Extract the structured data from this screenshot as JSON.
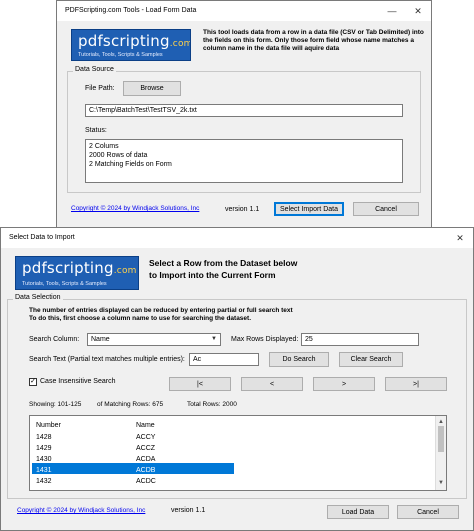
{
  "window1": {
    "title": "PDFScripting.com Tools - Load Form Data",
    "logo": {
      "main": "pdfscripting",
      "suffix": ".com",
      "tagline": "Tutorials, Tools, Scripts & Samples"
    },
    "description": "This tool loads data from a row in a data file (CSV or Tab Delimited) into the fields on this form. Only those form field whose name matches a column name in the data file will aquire data",
    "group_label": "Data Source",
    "file_path_label": "File Path:",
    "browse_label": "Browse",
    "file_path_value": "C:\\Temp\\BatchTest\\TestTSV_2k.txt",
    "status_label": "Status:",
    "status_lines": [
      "2 Colums",
      "2000 Rows of data",
      "2 Matching Fields on Form"
    ],
    "copyright": "Copyright © 2024 by Windjack Solutions, Inc",
    "version": "version 1.1",
    "select_import_label": "Select Import Data",
    "cancel_label": "Cancel",
    "min_glyph": "—",
    "close_glyph": "✕"
  },
  "window2": {
    "title": "Select Data to Import",
    "close_glyph": "✕",
    "logo": {
      "main": "pdfscripting",
      "suffix": ".com",
      "tagline": "Tutorials, Tools, Scripts & Samples"
    },
    "heading_line1": "Select a Row from the Dataset below",
    "heading_line2": "to Import into the Current Form",
    "group_label": "Data Selection",
    "instr_line1": "The number of entries displayed can be reduced by entering partial or full search text",
    "instr_line2": "To do this, first choose a column name to use for searching the dataset.",
    "search_column_label": "Search Column:",
    "search_column_value": "Name",
    "max_rows_label": "Max Rows Displayed:",
    "max_rows_value": "25",
    "search_text_label": "Search Text (Partial text matches multiple entries):",
    "search_text_value": "Ac",
    "do_search_label": "Do Search",
    "clear_search_label": "Clear Search",
    "case_insensitive_label": "Case Insensitive Search",
    "case_insensitive_checked": "✓",
    "nav_first": "|<",
    "nav_prev": "<",
    "nav_next": ">",
    "nav_last": ">|",
    "showing_label": "Showing: 101-125",
    "matching_label": "of Matching Rows: 675",
    "total_label": "Total Rows: 2000",
    "list_headers": [
      "Number",
      "Name"
    ],
    "list_rows": [
      [
        "1428",
        "ACCY"
      ],
      [
        "1429",
        "ACCZ"
      ],
      [
        "1430",
        "ACDA"
      ],
      [
        "1431",
        "ACDB"
      ],
      [
        "1432",
        "ACDC"
      ]
    ],
    "selected_row_index": 3,
    "scroll_up": "▲",
    "scroll_down": "▼",
    "copyright": "Copyright © 2024 by Windjack Solutions, Inc",
    "version": "version 1.1",
    "load_data_label": "Load Data",
    "cancel_label": "Cancel"
  }
}
